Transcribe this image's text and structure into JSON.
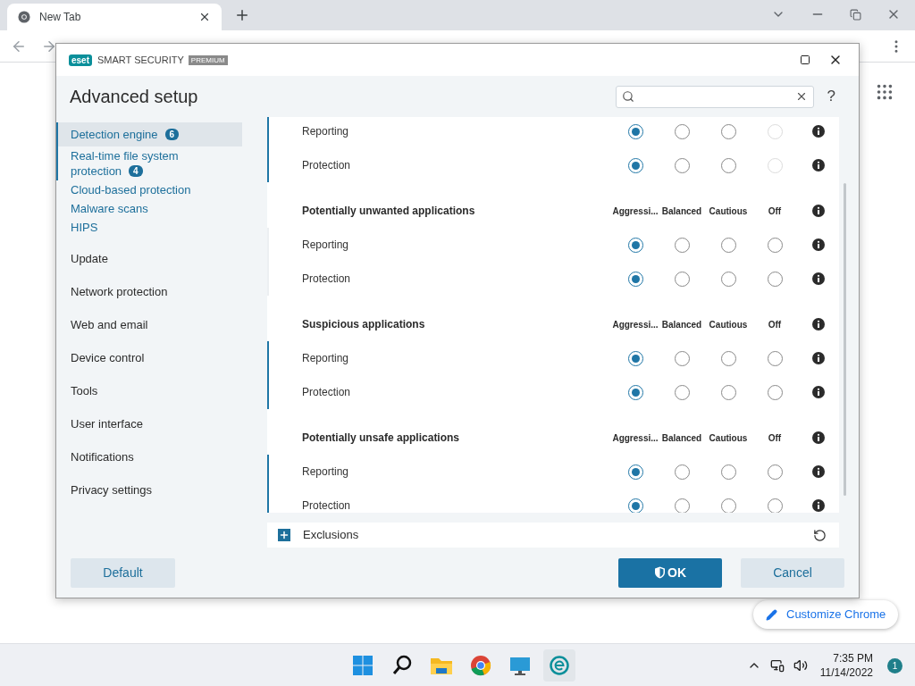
{
  "browser": {
    "tab": {
      "title": "New Tab"
    },
    "customize_button": "Customize Chrome"
  },
  "dialog": {
    "brand": {
      "logo": "eset",
      "product": "SMART SECURITY",
      "edition": "PREMIUM"
    },
    "title": "Advanced setup",
    "help": "?",
    "sidebar": {
      "items": [
        {
          "kind": "sub",
          "label": "Detection engine",
          "badge": "6",
          "selected": true
        },
        {
          "kind": "sub",
          "label": "Real-time file system protection",
          "badge": "4",
          "selected": false
        },
        {
          "kind": "sub",
          "label": "Cloud-based protection",
          "selected": false
        },
        {
          "kind": "sub",
          "label": "Malware scans",
          "selected": false
        },
        {
          "kind": "sub",
          "label": "HIPS",
          "selected": false
        },
        {
          "kind": "main",
          "label": "Update",
          "selected": false
        },
        {
          "kind": "main",
          "label": "Network protection",
          "selected": false
        },
        {
          "kind": "main",
          "label": "Web and email",
          "selected": false
        },
        {
          "kind": "main",
          "label": "Device control",
          "selected": false
        },
        {
          "kind": "main",
          "label": "Tools",
          "selected": false
        },
        {
          "kind": "main",
          "label": "User interface",
          "selected": false
        },
        {
          "kind": "main",
          "label": "Notifications",
          "selected": false
        },
        {
          "kind": "main",
          "label": "Privacy settings",
          "selected": false
        }
      ]
    },
    "sections": [
      {
        "modified": true,
        "rows": [
          {
            "label": "Reporting",
            "options": [
              {
                "selected": true,
                "disabled": false
              },
              {
                "selected": false,
                "disabled": false
              },
              {
                "selected": false,
                "disabled": false
              },
              {
                "selected": false,
                "disabled": true
              }
            ]
          },
          {
            "label": "Protection",
            "options": [
              {
                "selected": true,
                "disabled": false
              },
              {
                "selected": false,
                "disabled": false
              },
              {
                "selected": false,
                "disabled": false
              },
              {
                "selected": false,
                "disabled": true
              }
            ]
          }
        ]
      },
      {
        "title": "Potentially unwanted applications",
        "columns": [
          "Aggressi...",
          "Balanced",
          "Cautious",
          "Off"
        ],
        "modified": false,
        "rows": [
          {
            "label": "Reporting",
            "options": [
              {
                "selected": true,
                "disabled": false
              },
              {
                "selected": false,
                "disabled": false
              },
              {
                "selected": false,
                "disabled": false
              },
              {
                "selected": false,
                "disabled": false
              }
            ]
          },
          {
            "label": "Protection",
            "options": [
              {
                "selected": true,
                "disabled": false
              },
              {
                "selected": false,
                "disabled": false
              },
              {
                "selected": false,
                "disabled": false
              },
              {
                "selected": false,
                "disabled": false
              }
            ]
          }
        ]
      },
      {
        "title": "Suspicious applications",
        "columns": [
          "Aggressi...",
          "Balanced",
          "Cautious",
          "Off"
        ],
        "modified": true,
        "rows": [
          {
            "label": "Reporting",
            "options": [
              {
                "selected": true,
                "disabled": false
              },
              {
                "selected": false,
                "disabled": false
              },
              {
                "selected": false,
                "disabled": false
              },
              {
                "selected": false,
                "disabled": false
              }
            ]
          },
          {
            "label": "Protection",
            "options": [
              {
                "selected": true,
                "disabled": false
              },
              {
                "selected": false,
                "disabled": false
              },
              {
                "selected": false,
                "disabled": false
              },
              {
                "selected": false,
                "disabled": false
              }
            ]
          }
        ]
      },
      {
        "title": "Potentially unsafe applications",
        "columns": [
          "Aggressi...",
          "Balanced",
          "Cautious",
          "Off"
        ],
        "modified": true,
        "rows": [
          {
            "label": "Reporting",
            "options": [
              {
                "selected": true,
                "disabled": false
              },
              {
                "selected": false,
                "disabled": false
              },
              {
                "selected": false,
                "disabled": false
              },
              {
                "selected": false,
                "disabled": false
              }
            ]
          },
          {
            "label": "Protection",
            "options": [
              {
                "selected": true,
                "disabled": false
              },
              {
                "selected": false,
                "disabled": false
              },
              {
                "selected": false,
                "disabled": false
              },
              {
                "selected": false,
                "disabled": false
              }
            ]
          }
        ]
      }
    ],
    "exclusions": {
      "label": "Exclusions"
    },
    "buttons": {
      "default": "Default",
      "ok": "OK",
      "cancel": "Cancel"
    }
  },
  "taskbar": {
    "time": "7:35 PM",
    "date": "11/14/2022",
    "notifications": "1"
  }
}
